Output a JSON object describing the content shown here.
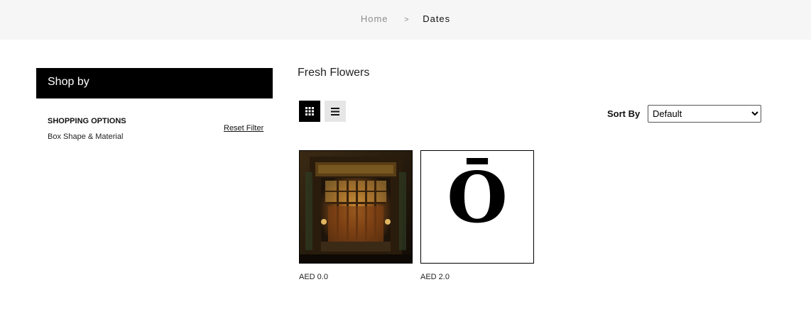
{
  "breadcrumb": {
    "home": "Home",
    "separator": ">",
    "current": "Dates"
  },
  "sidebar": {
    "title": "Shop by",
    "options_title": "SHOPPING OPTIONS",
    "reset_label": "Reset Filter",
    "filters": [
      {
        "label": "Box Shape & Material"
      }
    ]
  },
  "main": {
    "category_title": "Fresh Flowers",
    "view_modes": [
      "grid",
      "list"
    ],
    "active_view": "grid",
    "sort": {
      "label": "Sort By",
      "selected": "Default",
      "options": [
        "Default"
      ]
    },
    "products": [
      {
        "price": "AED 0.0",
        "image": "ornate-doorway-photo"
      },
      {
        "price": "AED 2.0",
        "image": "o-macron-logo",
        "logo_text": "Ō"
      }
    ]
  },
  "colors": {
    "header_bg": "#f6f6f6",
    "accent": "#000000",
    "list_btn_bg": "#e6e6e6"
  }
}
